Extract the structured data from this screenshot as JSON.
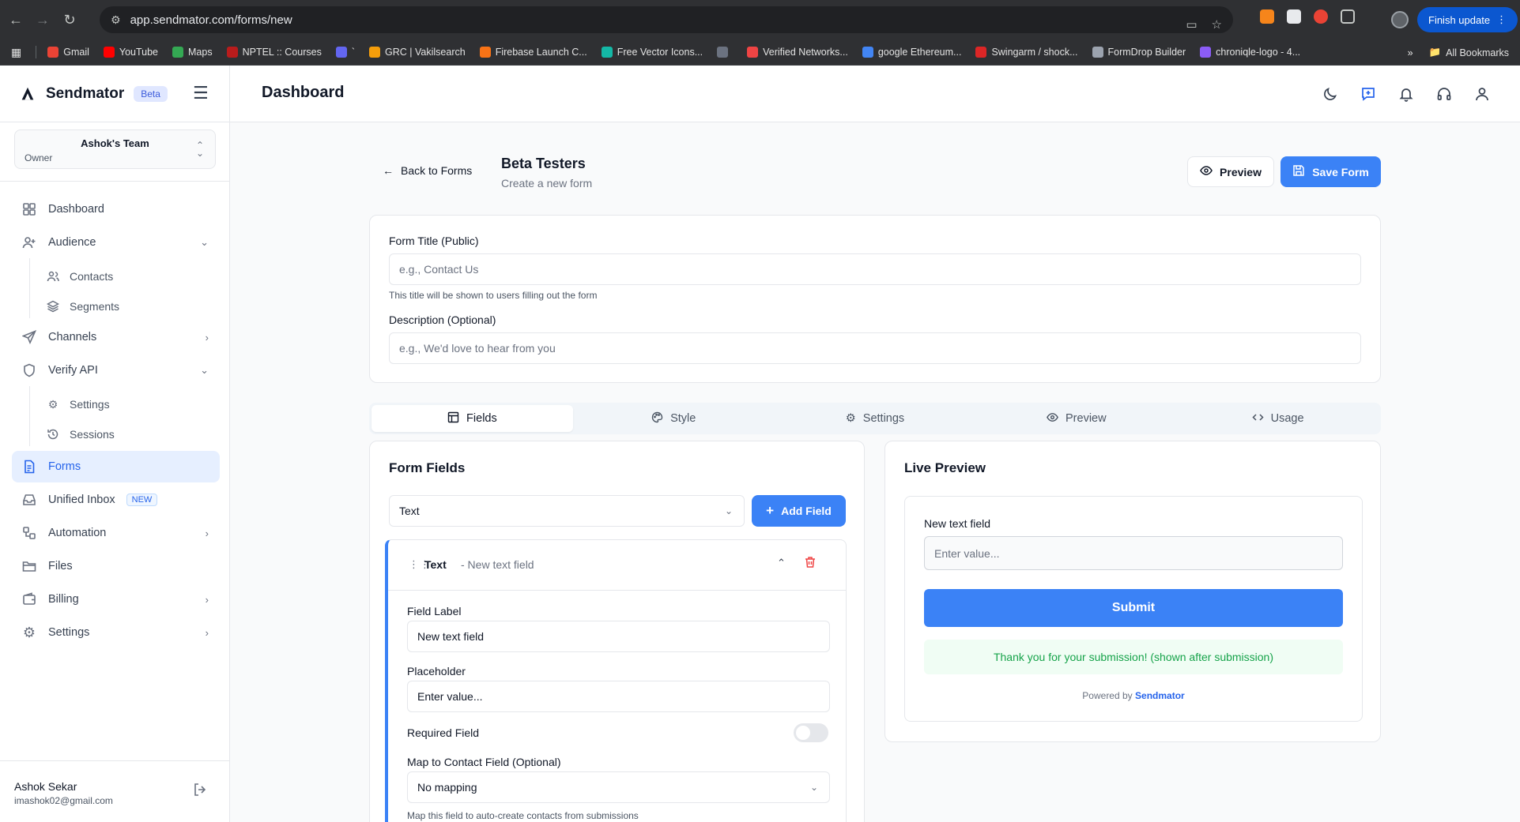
{
  "browser": {
    "url": "app.sendmator.com/forms/new",
    "finish_update": "Finish update",
    "bookmarks": [
      {
        "label": "Gmail",
        "color": "#ea4335"
      },
      {
        "label": "YouTube",
        "color": "#ff0000"
      },
      {
        "label": "Maps",
        "color": "#34a853"
      },
      {
        "label": "NPTEL :: Courses",
        "color": "#b91c1c"
      },
      {
        "label": "`",
        "color": "#6366f1"
      },
      {
        "label": "GRC | Vakilsearch",
        "color": "#f59e0b"
      },
      {
        "label": "Firebase Launch C...",
        "color": "#f97316"
      },
      {
        "label": "Free Vector Icons...",
        "color": "#14b8a6"
      },
      {
        "label": "",
        "color": "#6b7280"
      },
      {
        "label": "Verified Networks...",
        "color": "#ef4444"
      },
      {
        "label": "google Ethereum...",
        "color": "#4285f4"
      },
      {
        "label": "Swingarm / shock...",
        "color": "#dc2626"
      },
      {
        "label": "FormDrop Builder",
        "color": "#9ca3af"
      },
      {
        "label": "chroniqle-logo - 4...",
        "color": "#8b5cf6"
      }
    ],
    "all_bookmarks": "All Bookmarks",
    "more": "»"
  },
  "sidebar": {
    "brand": "Sendmator",
    "beta": "Beta",
    "team": {
      "name": "Ashok's Team",
      "role": "Owner"
    },
    "items": {
      "dashboard": "Dashboard",
      "audience": "Audience",
      "contacts": "Contacts",
      "segments": "Segments",
      "channels": "Channels",
      "verify_api": "Verify API",
      "settings_sub": "Settings",
      "sessions": "Sessions",
      "forms": "Forms",
      "unified_inbox": "Unified Inbox",
      "new_badge": "NEW",
      "automation": "Automation",
      "files": "Files",
      "billing": "Billing",
      "settings": "Settings"
    },
    "user": {
      "name": "Ashok Sekar",
      "email": "imashok02@gmail.com"
    }
  },
  "header": {
    "title": "Dashboard"
  },
  "form_page": {
    "back": "Back to Forms",
    "form_name": "Beta Testers",
    "form_subtitle": "Create a new form",
    "preview_btn": "Preview",
    "save_btn": "Save Form",
    "title_label": "Form Title (Public)",
    "title_placeholder": "e.g., Contact Us",
    "title_value": "",
    "title_hint": "This title will be shown to users filling out the form",
    "desc_label": "Description (Optional)",
    "desc_placeholder": "e.g., We'd love to hear from you",
    "desc_value": "",
    "tabs": {
      "fields": "Fields",
      "style": "Style",
      "settings": "Settings",
      "preview": "Preview",
      "usage": "Usage"
    }
  },
  "fields_panel": {
    "title": "Form Fields",
    "type_select": "Text",
    "add_field": "Add Field",
    "field": {
      "type": "Text",
      "name": "- New text field",
      "label_label": "Field Label",
      "label_value": "New text field",
      "placeholder_label": "Placeholder",
      "placeholder_value": "Enter value...",
      "required_label": "Required Field",
      "required": false,
      "map_label": "Map to Contact Field (Optional)",
      "map_value": "No mapping",
      "map_hint": "Map this field to auto-create contacts from submissions"
    }
  },
  "preview_panel": {
    "title": "Live Preview",
    "field_label": "New text field",
    "field_placeholder": "Enter value...",
    "submit": "Submit",
    "success": "Thank you for your submission! (shown after submission)",
    "powered_by": "Powered by",
    "powered_brand": "Sendmator"
  },
  "colors": {
    "accent": "#3b82f6",
    "active_nav_bg": "#e6efff",
    "danger": "#ef4444",
    "success": "#16a34a"
  }
}
